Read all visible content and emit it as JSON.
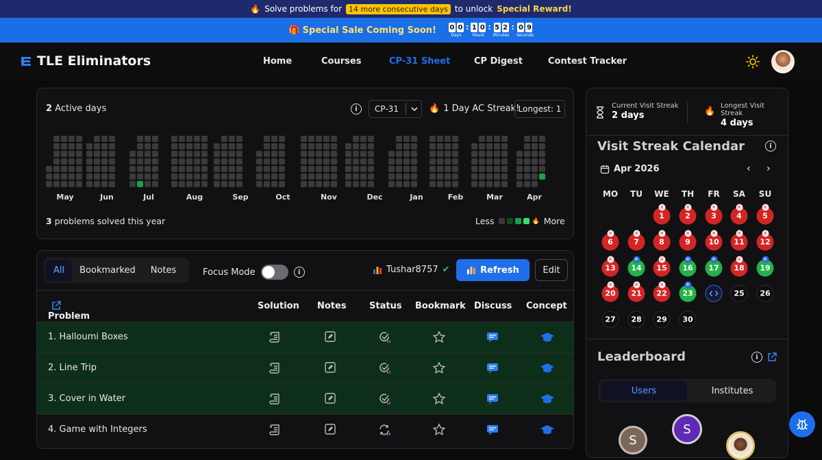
{
  "promo": {
    "prefix": "Solve problems for",
    "pill": "14 more consecutive days",
    "mid": "to unlock",
    "reward": "Special Reward!",
    "sale": "Special Sale Coming Soon!",
    "countdown": [
      {
        "digits": [
          "0",
          "0"
        ],
        "label": "Days"
      },
      {
        "digits": [
          "1",
          "0"
        ],
        "label": "Hours"
      },
      {
        "digits": [
          "5",
          "2"
        ],
        "label": "Minutes"
      },
      {
        "digits": [
          "0",
          "9"
        ],
        "label": "Seconds"
      }
    ]
  },
  "nav": {
    "brand": "TLE Eliminators",
    "links": [
      "Home",
      "Courses",
      "CP-31 Sheet",
      "CP Digest",
      "Contest Tracker"
    ],
    "active": "CP-31 Sheet"
  },
  "heatmap": {
    "active_days_count": "2",
    "active_days_label": "Active days",
    "sheet_select": "CP-31",
    "streak": "1 Day AC Streak!",
    "longest": "Longest: 1",
    "months": [
      "May",
      "Jun",
      "Jul",
      "Aug",
      "Sep",
      "Oct",
      "Nov",
      "Dec",
      "Jan",
      "Feb",
      "Mar",
      "Apr"
    ],
    "solved_count": "3",
    "solved_label": "problems solved this year",
    "less": "Less",
    "more": "More",
    "legend_colors": [
      "#3a3a3d",
      "#0e4d24",
      "#16a34a",
      "#3ddc6b"
    ]
  },
  "problems": {
    "tabs": [
      "All",
      "Bookmarked",
      "Notes"
    ],
    "focus_mode": "Focus Mode",
    "username": "Tushar8757",
    "refresh": "Refresh",
    "edit": "Edit",
    "columns": [
      "Problem",
      "Solution",
      "Notes",
      "Status",
      "Bookmark",
      "Discuss",
      "Concept"
    ],
    "rows": [
      {
        "name": "1. Halloumi Boxes",
        "solved": true
      },
      {
        "name": "2. Line Trip",
        "solved": true
      },
      {
        "name": "3. Cover in Water",
        "solved": true
      },
      {
        "name": "4. Game with Integers",
        "solved": false
      }
    ]
  },
  "sidebar": {
    "current_label": "Current Visit Streak",
    "current_value": "2 days",
    "longest_label": "Longest Visit Streak",
    "longest_value": "4 days",
    "calendar_title": "Visit Streak Calendar",
    "month": "Apr 2026",
    "weekdays": [
      "MO",
      "TU",
      "WE",
      "TH",
      "FR",
      "SA",
      "SU"
    ],
    "days": [
      {
        "d": "1",
        "s": "red"
      },
      {
        "d": "2",
        "s": "red"
      },
      {
        "d": "3",
        "s": "red"
      },
      {
        "d": "4",
        "s": "red"
      },
      {
        "d": "5",
        "s": "red"
      },
      {
        "d": "6",
        "s": "red"
      },
      {
        "d": "7",
        "s": "red"
      },
      {
        "d": "8",
        "s": "red"
      },
      {
        "d": "9",
        "s": "red"
      },
      {
        "d": "10",
        "s": "red"
      },
      {
        "d": "11",
        "s": "red"
      },
      {
        "d": "12",
        "s": "red"
      },
      {
        "d": "13",
        "s": "red"
      },
      {
        "d": "14",
        "s": "grn"
      },
      {
        "d": "15",
        "s": "red"
      },
      {
        "d": "16",
        "s": "grn"
      },
      {
        "d": "17",
        "s": "grn"
      },
      {
        "d": "18",
        "s": "red"
      },
      {
        "d": "19",
        "s": "grn"
      },
      {
        "d": "20",
        "s": "red"
      },
      {
        "d": "21",
        "s": "red"
      },
      {
        "d": "22",
        "s": "red"
      },
      {
        "d": "23",
        "s": "grn"
      },
      {
        "d": "",
        "s": "code"
      },
      {
        "d": "25",
        "s": "plain"
      },
      {
        "d": "26",
        "s": "plain"
      },
      {
        "d": "27",
        "s": "plain"
      },
      {
        "d": "28",
        "s": "plain"
      },
      {
        "d": "29",
        "s": "plain"
      },
      {
        "d": "30",
        "s": "plain"
      }
    ],
    "leaderboard_title": "Leaderboard",
    "lb_tabs": [
      "Users",
      "Institutes"
    ],
    "avatars": [
      "S",
      "S"
    ]
  }
}
